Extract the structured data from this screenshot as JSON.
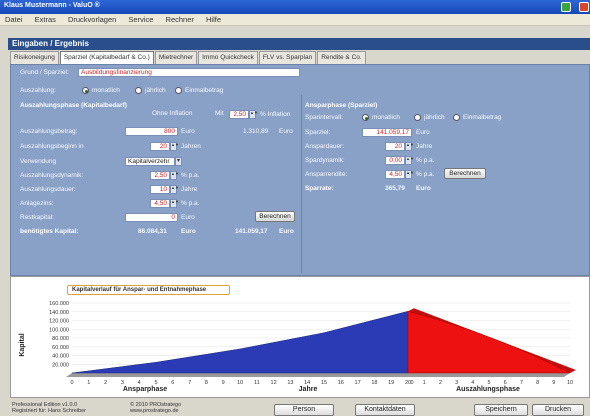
{
  "window": {
    "title": "Klaus Mustermann - ValuO ®"
  },
  "menu": [
    "Datei",
    "Extras",
    "Druckvorlagen",
    "Service",
    "Rechner",
    "Hilfe"
  ],
  "section_title": "Eingaben / Ergebnis",
  "tabs": [
    "Risikoneigung",
    "Sparziel (Kapitalbedarf & Co.)",
    "Mietrechner",
    "Immo Quickcheck",
    "FLV vs. Sparplan",
    "Rendite & Co."
  ],
  "form": {
    "grund_label": "Grund / Sparziel:",
    "grund_value": "Ausbildungsfinanzierung",
    "auszahlung_label": "Auszahlung:",
    "radio_monatlich": "monatlich",
    "radio_jaehrlich": "jährlich",
    "radio_einmal": "Einmalbetrag"
  },
  "left": {
    "header": "Auszahlungsphase (Kapitalbedarf)",
    "ohne_inflation": "Ohne Inflation",
    "mit": "Mit",
    "inflation_value": "2,50",
    "inflation_unit": "% Inflation",
    "rows": [
      {
        "label": "Auszahlungsbetrag:",
        "value": "800",
        "unit": "Euro",
        "extra": "1.310,89",
        "extra_unit": "Euro"
      },
      {
        "label": "Auszahlungsbeginn in",
        "value": "20",
        "unit": "Jahren"
      },
      {
        "label": "Verwendung",
        "value": "Kapitalverzehr"
      },
      {
        "label": "Auszahlungsdynamik:",
        "value": "2,50",
        "unit": "% p.a."
      },
      {
        "label": "Auszahlungsdauer:",
        "value": "10",
        "unit": "Jahre"
      },
      {
        "label": "Anlagezins:",
        "value": "4,50",
        "unit": "% p.a."
      },
      {
        "label": "Restkapital:",
        "value": "0",
        "unit": "Euro"
      }
    ],
    "berechnen": "Berechnen",
    "result_label": "benötigtes Kapital:",
    "result_ohne": "86.084,31",
    "result_ohne_unit": "Euro",
    "result_mit": "141.059,17",
    "result_mit_unit": "Euro"
  },
  "right": {
    "header": "Ansparphase (Sparziel)",
    "sparintervall_label": "Sparintervall:",
    "radio_monatlich": "monatlich",
    "radio_jaehrlich": "jährlich",
    "radio_einmal": "Einmalbetrag",
    "rows": [
      {
        "label": "Sparziel:",
        "value": "141.059,17",
        "unit": "Euro"
      },
      {
        "label": "Anspardauer:",
        "value": "20",
        "unit": "Jahre"
      },
      {
        "label": "Spardynamik:",
        "value": "0,00",
        "unit": "% p.a."
      },
      {
        "label": "Ansparrendite:",
        "value": "4,50",
        "unit": "% p.a."
      }
    ],
    "berechnen": "Berechnen",
    "sparrate_label": "Sparrate:",
    "sparrate_value": "365,79",
    "sparrate_unit": "Euro"
  },
  "chart_data": {
    "type": "area",
    "title": "Kapitalverlauf für Anspar- und Entnahmephase",
    "ylabel": "Kapital",
    "xlabel": "Jahre",
    "phase_labels": [
      "Ansparphase",
      "Auszahlungsphase"
    ],
    "yticks": [
      "20.000",
      "40.000",
      "60.000",
      "80.000",
      "100.000",
      "120.000",
      "140.000",
      "160.000"
    ],
    "ylim": [
      0,
      160000
    ],
    "x_anspar": [
      0,
      1,
      2,
      3,
      4,
      5,
      6,
      7,
      8,
      9,
      10,
      11,
      12,
      13,
      14,
      15,
      16,
      17,
      18,
      19,
      20
    ],
    "x_auszahlung": [
      0,
      1,
      2,
      3,
      4,
      5,
      6,
      7,
      8,
      9,
      10
    ],
    "series": [
      {
        "name": "Ansparphase",
        "color": "#2b3bb5",
        "x": [
          0,
          5,
          10,
          15,
          20
        ],
        "values": [
          0,
          24500,
          55000,
          92000,
          141059
        ]
      },
      {
        "name": "Auszahlungsphase",
        "color": "#ee1111",
        "x": [
          0,
          2,
          4,
          6,
          8,
          10
        ],
        "values": [
          141059,
          120000,
          96000,
          68000,
          36000,
          0
        ]
      }
    ]
  },
  "footer": {
    "edition": "Professional Edition v1.0.0",
    "registered": "Registriert für: Hans Schreiber",
    "copyright": "© 2010 PROstratego",
    "url": "www.prostratego.de",
    "buttons": [
      "Person",
      "Kontaktdaten",
      "Speichern",
      "Drucken"
    ]
  }
}
